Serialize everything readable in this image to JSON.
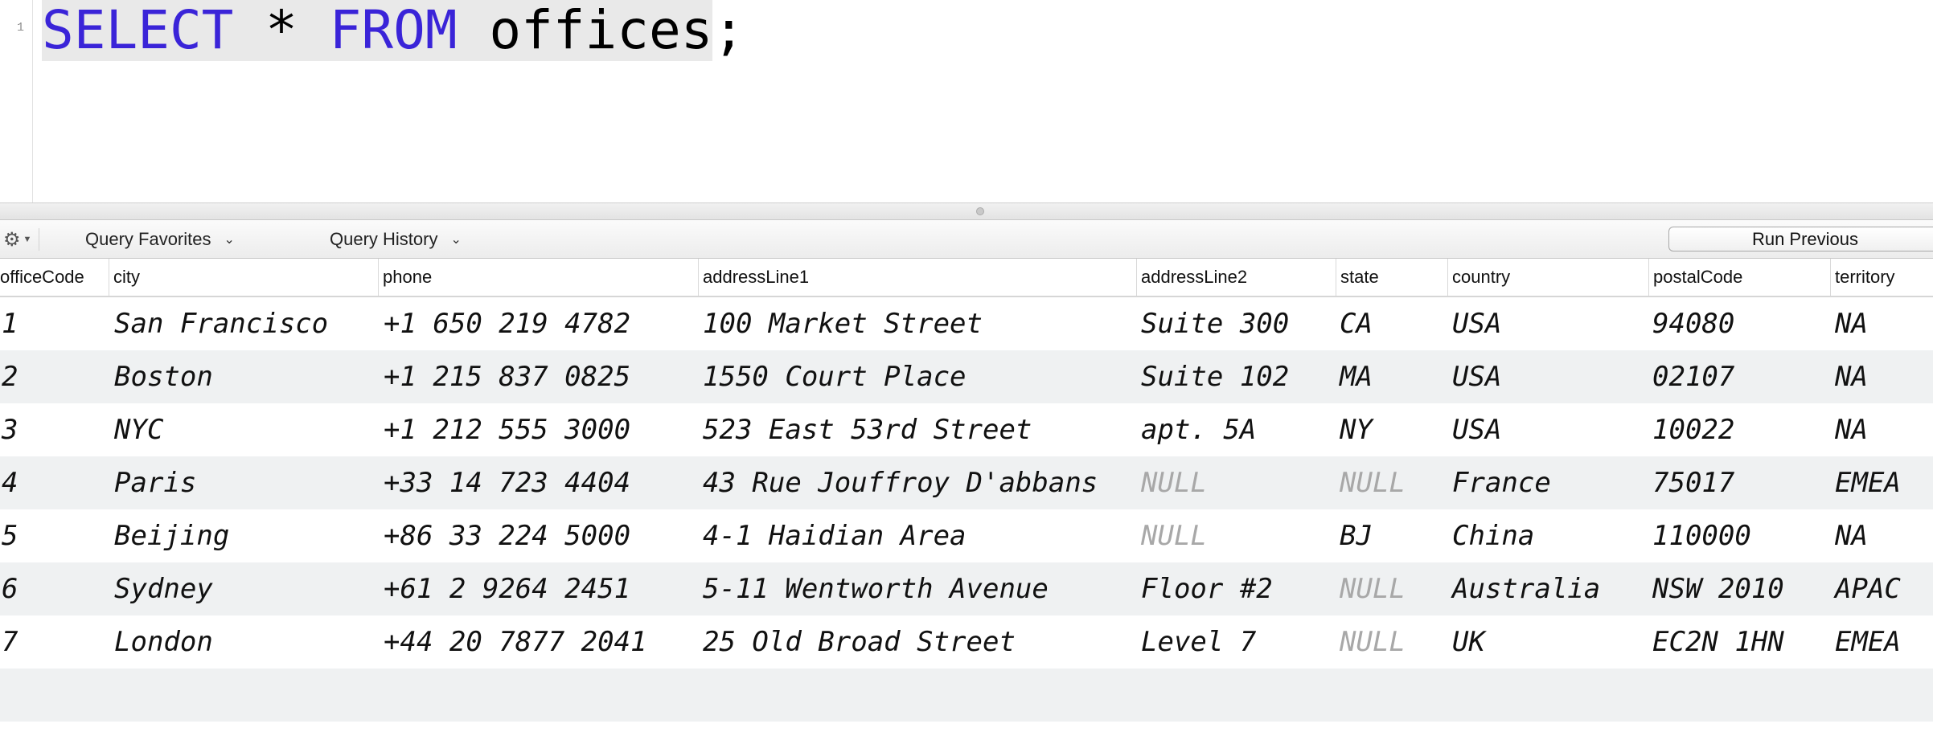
{
  "editor": {
    "line_number": "1",
    "code": {
      "kw1": "SELECT",
      "star": " * ",
      "kw2": "FROM",
      "rest": " offices",
      "semi": ";"
    }
  },
  "toolbar": {
    "gear_icon": "gear-icon",
    "query_favorites": "Query Favorites",
    "query_history": "Query History",
    "run_previous": "Run Previous"
  },
  "columns": [
    "officeCode",
    "city",
    "phone",
    "addressLine1",
    "addressLine2",
    "state",
    "country",
    "postalCode",
    "territory"
  ],
  "rows": [
    [
      "1",
      "San Francisco",
      "+1 650 219 4782",
      "100 Market Street",
      "Suite 300",
      "CA",
      "USA",
      "94080",
      "NA"
    ],
    [
      "2",
      "Boston",
      "+1 215 837 0825",
      "1550 Court Place",
      "Suite 102",
      "MA",
      "USA",
      "02107",
      "NA"
    ],
    [
      "3",
      "NYC",
      "+1 212 555 3000",
      "523 East 53rd Street",
      "apt. 5A",
      "NY",
      "USA",
      "10022",
      "NA"
    ],
    [
      "4",
      "Paris",
      "+33 14 723 4404",
      "43 Rue Jouffroy D'abbans",
      "NULL",
      "NULL",
      "France",
      "75017",
      "EMEA"
    ],
    [
      "5",
      "Beijing",
      "+86 33 224 5000",
      "4-1 Haidian Area",
      "NULL",
      "BJ",
      "China",
      "110000",
      "NA"
    ],
    [
      "6",
      "Sydney",
      "+61 2 9264 2451",
      "5-11 Wentworth Avenue",
      "Floor #2",
      "NULL",
      "Australia",
      "NSW 2010",
      "APAC"
    ],
    [
      "7",
      "London",
      "+44 20 7877 2041",
      "25 Old Broad Street",
      "Level 7",
      "NULL",
      "UK",
      "EC2N 1HN",
      "EMEA"
    ]
  ],
  "colors": {
    "keyword": "#3a24d8",
    "null_text": "#a8a8a8",
    "alt_row": "#eff1f2"
  }
}
